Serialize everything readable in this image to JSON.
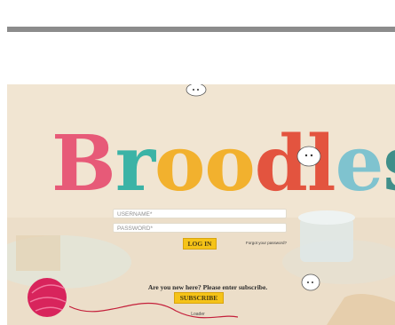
{
  "header": {
    "divider": "top-divider"
  },
  "logo": {
    "letters": [
      "B",
      "r",
      "o",
      "o",
      "d",
      "l",
      "e",
      "s"
    ],
    "colors": [
      "#e75a78",
      "#3bb3a6",
      "#f2b12e",
      "#f2b12e",
      "#e3543f",
      "#e3543f",
      "#7fc3cf",
      "#3f8f8a"
    ]
  },
  "login": {
    "username_placeholder": "USERNAME*",
    "password_placeholder": "PASSWORD*",
    "login_label": "LOG IN",
    "forgot_label": "Forgot your password?"
  },
  "signup": {
    "prompt": "Are you new here? Please enter subscribe.",
    "subscribe_label": "SUBSCRIBE",
    "footer_link": "Loader"
  },
  "colors": {
    "button": "#f5c318",
    "background": "#f2e6d3",
    "yarn": "#d8245c"
  },
  "icons": [
    "yarn-ball-icon",
    "sheep-doodle-icon"
  ]
}
